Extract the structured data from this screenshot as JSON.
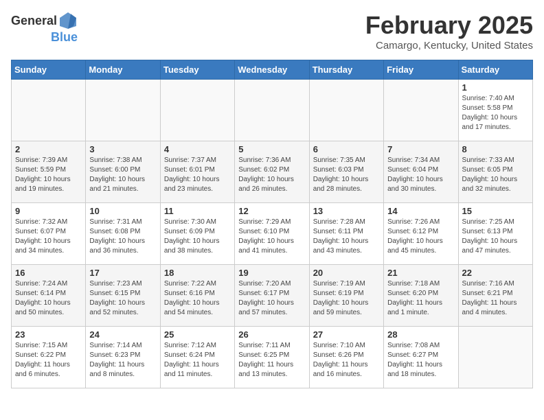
{
  "header": {
    "logo_general": "General",
    "logo_blue": "Blue",
    "title": "February 2025",
    "subtitle": "Camargo, Kentucky, United States"
  },
  "calendar": {
    "days_of_week": [
      "Sunday",
      "Monday",
      "Tuesday",
      "Wednesday",
      "Thursday",
      "Friday",
      "Saturday"
    ],
    "weeks": [
      [
        {
          "day": "",
          "info": ""
        },
        {
          "day": "",
          "info": ""
        },
        {
          "day": "",
          "info": ""
        },
        {
          "day": "",
          "info": ""
        },
        {
          "day": "",
          "info": ""
        },
        {
          "day": "",
          "info": ""
        },
        {
          "day": "1",
          "info": "Sunrise: 7:40 AM\nSunset: 5:58 PM\nDaylight: 10 hours and 17 minutes."
        }
      ],
      [
        {
          "day": "2",
          "info": "Sunrise: 7:39 AM\nSunset: 5:59 PM\nDaylight: 10 hours and 19 minutes."
        },
        {
          "day": "3",
          "info": "Sunrise: 7:38 AM\nSunset: 6:00 PM\nDaylight: 10 hours and 21 minutes."
        },
        {
          "day": "4",
          "info": "Sunrise: 7:37 AM\nSunset: 6:01 PM\nDaylight: 10 hours and 23 minutes."
        },
        {
          "day": "5",
          "info": "Sunrise: 7:36 AM\nSunset: 6:02 PM\nDaylight: 10 hours and 26 minutes."
        },
        {
          "day": "6",
          "info": "Sunrise: 7:35 AM\nSunset: 6:03 PM\nDaylight: 10 hours and 28 minutes."
        },
        {
          "day": "7",
          "info": "Sunrise: 7:34 AM\nSunset: 6:04 PM\nDaylight: 10 hours and 30 minutes."
        },
        {
          "day": "8",
          "info": "Sunrise: 7:33 AM\nSunset: 6:05 PM\nDaylight: 10 hours and 32 minutes."
        }
      ],
      [
        {
          "day": "9",
          "info": "Sunrise: 7:32 AM\nSunset: 6:07 PM\nDaylight: 10 hours and 34 minutes."
        },
        {
          "day": "10",
          "info": "Sunrise: 7:31 AM\nSunset: 6:08 PM\nDaylight: 10 hours and 36 minutes."
        },
        {
          "day": "11",
          "info": "Sunrise: 7:30 AM\nSunset: 6:09 PM\nDaylight: 10 hours and 38 minutes."
        },
        {
          "day": "12",
          "info": "Sunrise: 7:29 AM\nSunset: 6:10 PM\nDaylight: 10 hours and 41 minutes."
        },
        {
          "day": "13",
          "info": "Sunrise: 7:28 AM\nSunset: 6:11 PM\nDaylight: 10 hours and 43 minutes."
        },
        {
          "day": "14",
          "info": "Sunrise: 7:26 AM\nSunset: 6:12 PM\nDaylight: 10 hours and 45 minutes."
        },
        {
          "day": "15",
          "info": "Sunrise: 7:25 AM\nSunset: 6:13 PM\nDaylight: 10 hours and 47 minutes."
        }
      ],
      [
        {
          "day": "16",
          "info": "Sunrise: 7:24 AM\nSunset: 6:14 PM\nDaylight: 10 hours and 50 minutes."
        },
        {
          "day": "17",
          "info": "Sunrise: 7:23 AM\nSunset: 6:15 PM\nDaylight: 10 hours and 52 minutes."
        },
        {
          "day": "18",
          "info": "Sunrise: 7:22 AM\nSunset: 6:16 PM\nDaylight: 10 hours and 54 minutes."
        },
        {
          "day": "19",
          "info": "Sunrise: 7:20 AM\nSunset: 6:17 PM\nDaylight: 10 hours and 57 minutes."
        },
        {
          "day": "20",
          "info": "Sunrise: 7:19 AM\nSunset: 6:19 PM\nDaylight: 10 hours and 59 minutes."
        },
        {
          "day": "21",
          "info": "Sunrise: 7:18 AM\nSunset: 6:20 PM\nDaylight: 11 hours and 1 minute."
        },
        {
          "day": "22",
          "info": "Sunrise: 7:16 AM\nSunset: 6:21 PM\nDaylight: 11 hours and 4 minutes."
        }
      ],
      [
        {
          "day": "23",
          "info": "Sunrise: 7:15 AM\nSunset: 6:22 PM\nDaylight: 11 hours and 6 minutes."
        },
        {
          "day": "24",
          "info": "Sunrise: 7:14 AM\nSunset: 6:23 PM\nDaylight: 11 hours and 8 minutes."
        },
        {
          "day": "25",
          "info": "Sunrise: 7:12 AM\nSunset: 6:24 PM\nDaylight: 11 hours and 11 minutes."
        },
        {
          "day": "26",
          "info": "Sunrise: 7:11 AM\nSunset: 6:25 PM\nDaylight: 11 hours and 13 minutes."
        },
        {
          "day": "27",
          "info": "Sunrise: 7:10 AM\nSunset: 6:26 PM\nDaylight: 11 hours and 16 minutes."
        },
        {
          "day": "28",
          "info": "Sunrise: 7:08 AM\nSunset: 6:27 PM\nDaylight: 11 hours and 18 minutes."
        },
        {
          "day": "",
          "info": ""
        }
      ]
    ]
  }
}
